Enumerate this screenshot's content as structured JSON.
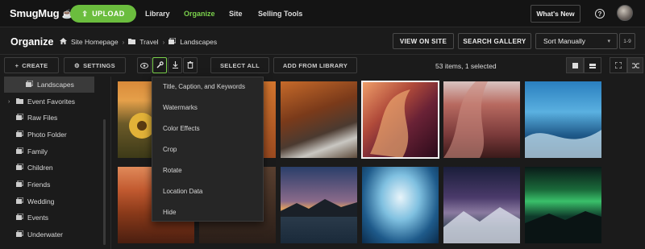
{
  "topbar": {
    "logo": "SmugMug",
    "upload_label": "UPLOAD",
    "nav": [
      "Library",
      "Organize",
      "Site",
      "Selling Tools"
    ],
    "active_nav": "Organize",
    "whats_new": "What's New",
    "help_glyph": "?"
  },
  "pagebar": {
    "title": "Organize",
    "breadcrumb": [
      "Site Homepage",
      "Travel",
      "Landscapes"
    ],
    "view_on_site": "VIEW ON SITE",
    "search_gallery": "SEARCH GALLERY",
    "sort_value": "Sort Manually",
    "range": "1-9"
  },
  "toolbar": {
    "create": "CREATE",
    "settings": "SETTINGS",
    "select_all": "SELECT ALL",
    "add_from_library": "ADD FROM LIBRARY",
    "status": "53 items, 1 selected"
  },
  "sidebar": {
    "items": [
      "Landscapes",
      "Event Favorites",
      "Raw Files",
      "Photo Folder",
      "Family",
      "Children",
      "Friends",
      "Wedding",
      "Events",
      "Underwater"
    ],
    "selected": "Landscapes"
  },
  "menu": {
    "items": [
      "Title, Caption, and Keywords",
      "Watermarks",
      "Color Effects",
      "Crop",
      "Rotate",
      "Location Data",
      "Hide"
    ]
  },
  "colors": {
    "accent_green": "#6bbd3e",
    "background": "#1b1b1b",
    "header": "#141414"
  },
  "icons": [
    "upload-icon",
    "home-icon",
    "folder-icon",
    "eye-icon",
    "wrench-icon",
    "download-icon",
    "trash-icon",
    "gear-icon",
    "plus-icon",
    "chevron-down-icon",
    "question-icon",
    "grid-icon",
    "list-icon",
    "fullscreen-icon",
    "shuffle-icon"
  ]
}
